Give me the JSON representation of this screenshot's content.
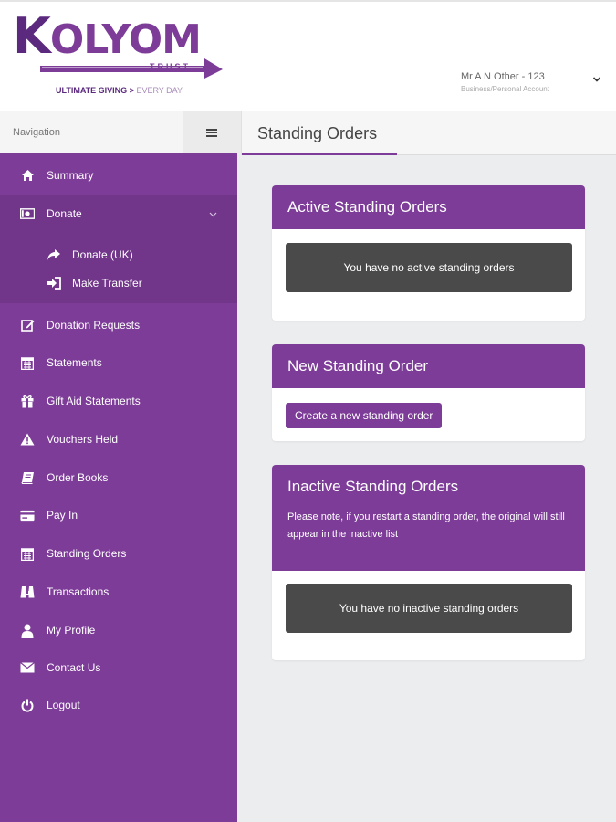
{
  "logo": {
    "brand": "KOLYOM",
    "brand_k": "K",
    "brand_rest": "OLYOM",
    "sub": "TRUST",
    "tagline_main": "ULTIMATE GIVING >",
    "tagline_accent": "EVERY DAY"
  },
  "user": {
    "name": "Mr A N Other - 123",
    "account_type": "Business/Personal Account"
  },
  "navigation": {
    "label": "Navigation",
    "items": [
      {
        "label": "Summary",
        "icon": "home-icon"
      },
      {
        "label": "Donate",
        "icon": "money-icon"
      },
      {
        "label": "Donate (UK)",
        "icon": "share-arrow-icon"
      },
      {
        "label": "Make Transfer",
        "icon": "sign-in-icon"
      },
      {
        "label": "Donation Requests",
        "icon": "edit-icon"
      },
      {
        "label": "Statements",
        "icon": "calendar-icon"
      },
      {
        "label": "Gift Aid Statements",
        "icon": "gift-icon"
      },
      {
        "label": "Vouchers Held",
        "icon": "warning-icon"
      },
      {
        "label": "Order Books",
        "icon": "book-icon"
      },
      {
        "label": "Pay In",
        "icon": "credit-card-icon"
      },
      {
        "label": "Standing Orders",
        "icon": "calendar-icon"
      },
      {
        "label": "Transactions",
        "icon": "binoculars-icon"
      },
      {
        "label": "My Profile",
        "icon": "user-icon"
      },
      {
        "label": "Contact Us",
        "icon": "envelope-icon"
      },
      {
        "label": "Logout",
        "icon": "power-icon"
      }
    ]
  },
  "page": {
    "title": "Standing Orders"
  },
  "panels": {
    "active": {
      "title": "Active Standing Orders",
      "empty": "You have no active standing orders"
    },
    "new": {
      "title": "New Standing Order",
      "button": "Create a new standing order"
    },
    "inactive": {
      "title": "Inactive Standing Orders",
      "note": "Please note, if you restart a standing order, the original will still appear in the inactive list",
      "empty": "You have no inactive standing orders"
    }
  },
  "colors": {
    "brand_purple": "#7d3c98",
    "dark_purple": "#5b2a7e",
    "empty_box": "#4a4a4a"
  }
}
